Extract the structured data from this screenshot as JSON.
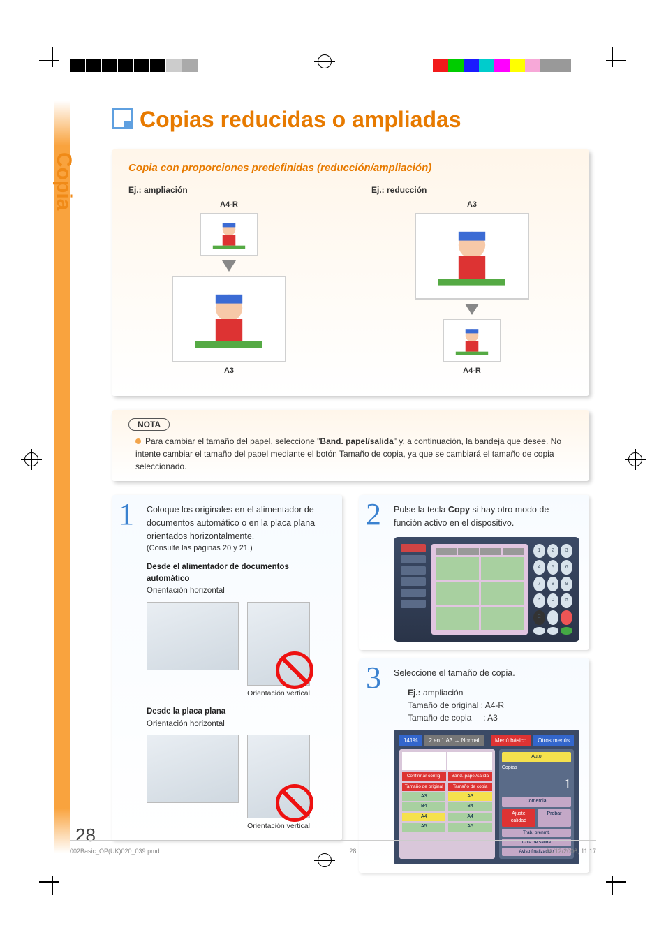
{
  "sideTab": "Copia",
  "title": "Copias reducidas o ampliadas",
  "subheading": "Copia con proporciones predefinidas (reducción/ampliación)",
  "enlarge": {
    "heading": "Ej.: ampliación",
    "topLabel": "A4-R",
    "bottomLabel": "A3"
  },
  "reduce": {
    "heading": "Ej.: reducción",
    "topLabel": "A3",
    "bottomLabel": "A4-R"
  },
  "nota": {
    "label": "NOTA",
    "text_pre": "Para cambiar el tamaño del papel, seleccione \"",
    "text_bold": "Band. papel/salida",
    "text_post": "\" y, a continuación, la bandeja que desee. No intente cambiar el tamaño del papel mediante el botón Tamaño de copia, ya que se cambiará el tamaño de copia seleccionado."
  },
  "step1": {
    "num": "1",
    "p1": "Coloque los originales en el alimentador de documentos automático o en la placa plana orientados horizontalmente.",
    "p2": "(Consulte las páginas 20 y 21.)",
    "h1": "Desde el alimentador de documentos automático",
    "l1": "Orientación horizontal",
    "c1": "Orientación vertical",
    "h2": "Desde la placa plana",
    "l2": "Orientación horizontal",
    "c2": "Orientación vertical"
  },
  "step2": {
    "num": "2",
    "p_pre": "Pulse la tecla ",
    "p_bold": "Copy",
    "p_post": " si hay otro modo de función activo en el dispositivo."
  },
  "step3": {
    "num": "3",
    "p1": "Seleccione el tamaño de copia.",
    "ej_label": "Ej.:",
    "ej_val": "ampliación",
    "l1": "Tamaño de original : A4-R",
    "l2": "Tamaño de copia     : A3",
    "screen": {
      "ratio": "141%",
      "mode": "2 en 1 A3 → Normal",
      "menuBasic": "Menú básico",
      "otherMenus": "Otros menús",
      "auto": "Auto",
      "copias": "Copias",
      "copynum": "1",
      "comercial": "Comercial",
      "confirm": "Confirmar config.",
      "band": "Band. papel/salida",
      "ajuste": "Ajuste calidad",
      "probar": "Probar",
      "col1h": "Tamaño de original",
      "col2h": "Tamaño de copia",
      "sizes": [
        "A3",
        "B4",
        "A4",
        "A5"
      ],
      "trab": "Trab. prenmt.",
      "cola": "Cola de salida",
      "aviso": "Aviso finalización"
    }
  },
  "pageNumber": "28",
  "footer": {
    "file": "002Basic_OP(UK)020_039.pmd",
    "pg": "28",
    "date": "14/12/2006, 11:17"
  }
}
